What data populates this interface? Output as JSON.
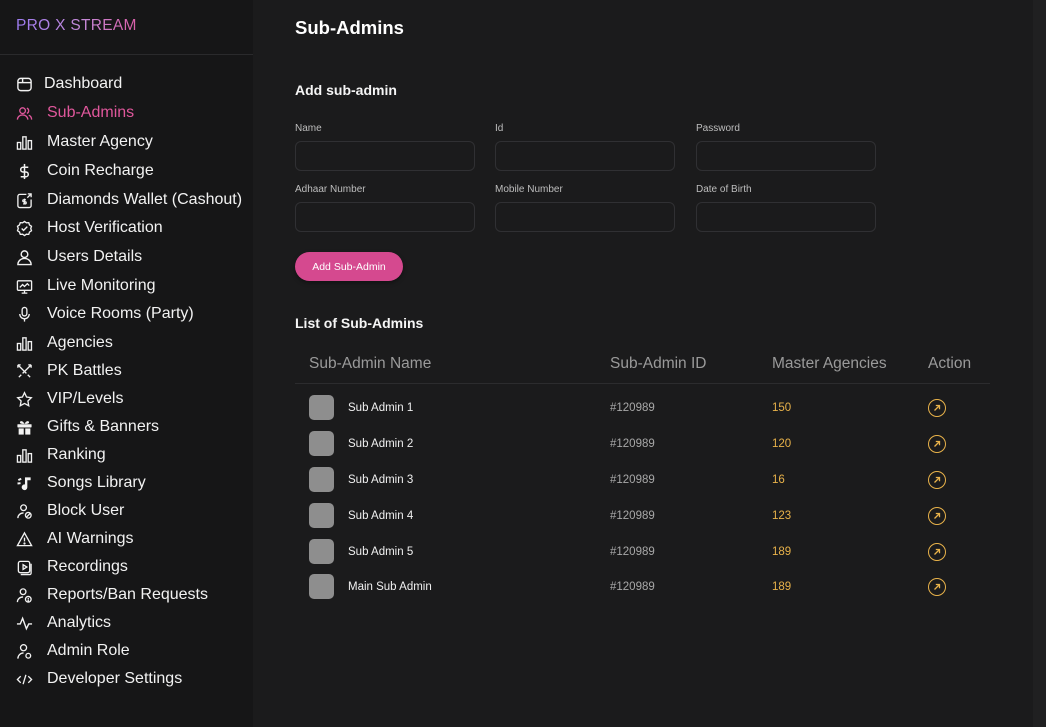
{
  "brand": "PRO X STREAM",
  "accent_color": "#d5498f",
  "sidebar": {
    "items": [
      {
        "label": "Dashboard",
        "icon": "dashboard-icon"
      },
      {
        "label": "Sub-Admins",
        "icon": "users-icon",
        "active": true
      },
      {
        "label": "Master Agency",
        "icon": "bar-chart-icon"
      },
      {
        "label": "Coin Recharge",
        "icon": "dollar-icon"
      },
      {
        "label": "Diamonds Wallet (Cashout)",
        "icon": "wallet-icon"
      },
      {
        "label": "Host Verification",
        "icon": "verified-badge-icon"
      },
      {
        "label": "Users Details",
        "icon": "user-icon"
      },
      {
        "label": "Live Monitoring",
        "icon": "monitor-icon"
      },
      {
        "label": "Voice Rooms (Party)",
        "icon": "microphone-icon"
      },
      {
        "label": "Agencies",
        "icon": "bar-chart-icon"
      },
      {
        "label": "PK Battles",
        "icon": "crossed-swords-icon"
      },
      {
        "label": "VIP/Levels",
        "icon": "star-icon"
      },
      {
        "label": "Gifts & Banners",
        "icon": "gift-icon"
      },
      {
        "label": "Ranking",
        "icon": "bar-chart-icon"
      },
      {
        "label": "Songs Library",
        "icon": "music-note-icon"
      },
      {
        "label": "Block User",
        "icon": "block-user-icon"
      },
      {
        "label": "AI Warnings",
        "icon": "warning-icon"
      },
      {
        "label": "Recordings",
        "icon": "recording-icon"
      },
      {
        "label": "Reports/Ban Requests",
        "icon": "report-user-icon"
      },
      {
        "label": "Analytics",
        "icon": "activity-icon"
      },
      {
        "label": "Admin Role",
        "icon": "admin-user-icon"
      },
      {
        "label": "Developer Settings",
        "icon": "code-icon"
      }
    ]
  },
  "main": {
    "title": "Sub-Admins",
    "form": {
      "title": "Add sub-admin",
      "fields": [
        {
          "label": "Name",
          "value": "",
          "placeholder": ""
        },
        {
          "label": "Id",
          "value": "",
          "placeholder": ""
        },
        {
          "label": "Password",
          "value": "",
          "placeholder": ""
        },
        {
          "label": "Adhaar Number",
          "value": "",
          "placeholder": ""
        },
        {
          "label": "Mobile Number",
          "value": "",
          "placeholder": ""
        },
        {
          "label": "Date of Birth",
          "value": "",
          "placeholder": ""
        }
      ],
      "submit_label": "Add Sub-Admin"
    },
    "list": {
      "title": "List of Sub-Admins",
      "columns": [
        "Sub-Admin Name",
        "Sub-Admin ID",
        "Master Agencies",
        "Action"
      ],
      "rows": [
        {
          "name": "Sub Admin 1",
          "id": "#120989",
          "master_agencies": "150"
        },
        {
          "name": "Sub Admin 2",
          "id": "#120989",
          "master_agencies": "120"
        },
        {
          "name": "Sub Admin 3",
          "id": "#120989",
          "master_agencies": "16"
        },
        {
          "name": "Sub Admin 4",
          "id": "#120989",
          "master_agencies": "123"
        },
        {
          "name": "Sub Admin 5",
          "id": "#120989",
          "master_agencies": "189"
        },
        {
          "name": "Main Sub Admin",
          "id": "#120989",
          "master_agencies": "189"
        }
      ]
    }
  }
}
